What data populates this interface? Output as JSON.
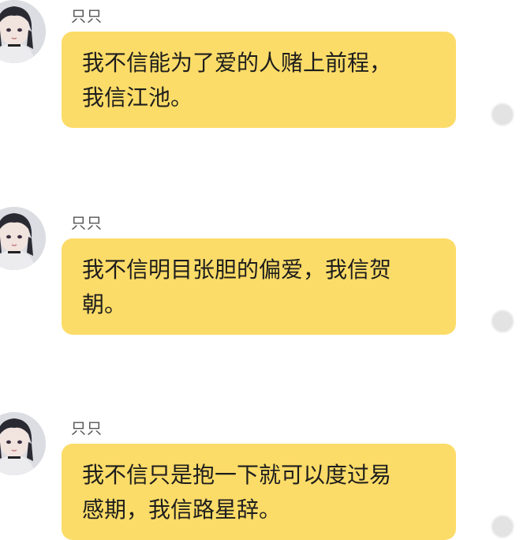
{
  "messages": [
    {
      "sender": "只只",
      "lines": [
        "我不信能为了爱的人赌上前程，",
        "我信江池。"
      ]
    },
    {
      "sender": "只只",
      "lines": [
        "我不信明目张胆的偏爱，我信贺",
        "朝。"
      ]
    },
    {
      "sender": "只只",
      "lines": [
        "我不信只是抱一下就可以度过易",
        "感期，我信路星辞。"
      ]
    }
  ],
  "colors": {
    "bubble": "#fcdc68",
    "text": "#1d1d1d",
    "sender": "#555555",
    "select_dot": "#e3e3e3"
  }
}
